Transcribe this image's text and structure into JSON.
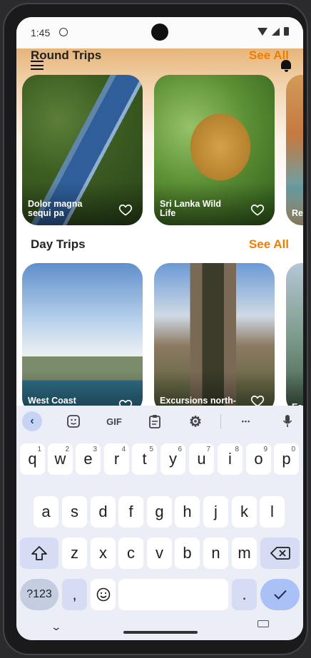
{
  "status": {
    "time": "1:45"
  },
  "round_trips": {
    "title": "Round Trips",
    "see_all": "See All",
    "cards": [
      {
        "label": "Dolor magna sequi pa"
      },
      {
        "label": "Sri Lanka Wild Life"
      },
      {
        "label": "Re Ge"
      }
    ]
  },
  "day_trips": {
    "title": "Day Trips",
    "see_all": "See All",
    "cards": [
      {
        "label": "West Coast Excursions"
      },
      {
        "label": "Excursions north-west coast"
      },
      {
        "label": "Ea Ex"
      }
    ]
  },
  "keyboard": {
    "toolbar": {
      "gif": "GIF",
      "more": "•••"
    },
    "row1": [
      {
        "k": "q",
        "h": "1"
      },
      {
        "k": "w",
        "h": "2"
      },
      {
        "k": "e",
        "h": "3"
      },
      {
        "k": "r",
        "h": "4"
      },
      {
        "k": "t",
        "h": "5"
      },
      {
        "k": "y",
        "h": "6"
      },
      {
        "k": "u",
        "h": "7"
      },
      {
        "k": "i",
        "h": "8"
      },
      {
        "k": "o",
        "h": "9"
      },
      {
        "k": "p",
        "h": "0"
      }
    ],
    "row2": [
      "a",
      "s",
      "d",
      "f",
      "g",
      "h",
      "j",
      "k",
      "l"
    ],
    "row3": [
      "z",
      "x",
      "c",
      "v",
      "b",
      "n",
      "m"
    ],
    "sym_label": "?123",
    "comma": ",",
    "period": "."
  },
  "colors": {
    "accent": "#f07d00",
    "kb_bg": "#eceef7",
    "enter": "#a9c1f7"
  }
}
